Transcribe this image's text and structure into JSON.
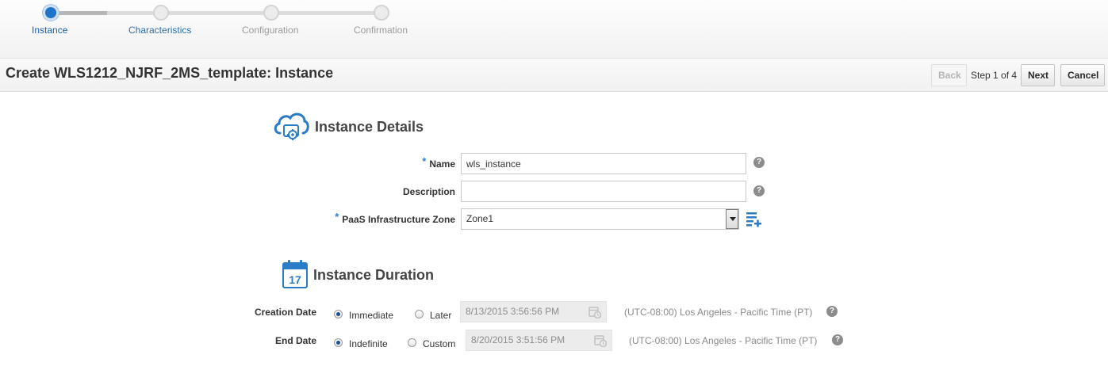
{
  "train": {
    "steps": [
      {
        "label": "Instance",
        "state": "current"
      },
      {
        "label": "Characteristics",
        "state": "link"
      },
      {
        "label": "Configuration",
        "state": "upcoming"
      },
      {
        "label": "Confirmation",
        "state": "upcoming"
      }
    ]
  },
  "header": {
    "title": "Create WLS1212_NJRF_2MS_template: Instance",
    "back_label": "Back",
    "step_text": "Step 1 of 4",
    "next_label": "Next",
    "cancel_label": "Cancel"
  },
  "instance_details": {
    "section_title": "Instance Details",
    "section_icon": "cloud-gear-icon",
    "name_label": "Name",
    "name_value": "wls_instance",
    "description_label": "Description",
    "description_value": "",
    "zone_label": "PaaS Infrastructure Zone",
    "zone_value": "Zone1",
    "required_marker": "*",
    "help_glyph": "?"
  },
  "instance_duration": {
    "section_title": "Instance Duration",
    "section_icon": "calendar-icon",
    "calendar_day": "17",
    "creation_date_label": "Creation Date",
    "creation_options": [
      {
        "label": "Immediate",
        "checked": true
      },
      {
        "label": "Later",
        "checked": false
      }
    ],
    "creation_date_value": "8/13/2015 3:56:56 PM",
    "creation_timezone": "(UTC-08:00) Los Angeles - Pacific Time (PT)",
    "end_date_label": "End Date",
    "end_options": [
      {
        "label": "Indefinite",
        "checked": true
      },
      {
        "label": "Custom",
        "checked": false
      }
    ],
    "end_date_value": "8/20/2015 3:51:56 PM",
    "end_timezone": "(UTC-08:00) Los Angeles - Pacific Time (PT)"
  },
  "colors": {
    "accent": "#1f73c9",
    "required": "#2b7fd4",
    "icon_blue": "#2a7cc7"
  }
}
